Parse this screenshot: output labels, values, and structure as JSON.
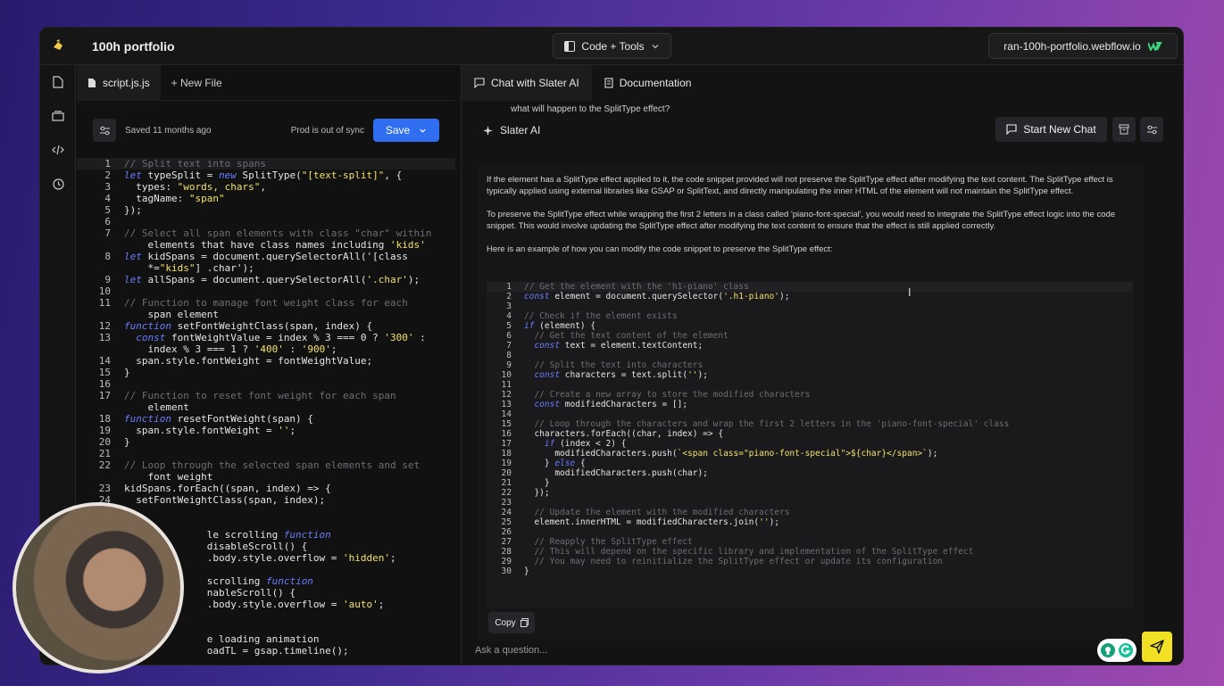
{
  "topbar": {
    "project_title": "100h portfolio",
    "mode_label": "Code + Tools",
    "domain_label": "ran-100h-portfolio.webflow.io"
  },
  "editor": {
    "tabs": [
      {
        "label": "script.js.js",
        "icon": "file-icon"
      },
      {
        "label": "+ New File",
        "icon": "plus-icon"
      }
    ],
    "saved_text": "Saved 11 months ago",
    "sync_text": "Prod is out of sync",
    "save_label": "Save",
    "lines": [
      {
        "n": "1",
        "t": "// Split text into spans"
      },
      {
        "n": "2",
        "t": "let typeSplit = new SplitType(\"[text-split]\", {"
      },
      {
        "n": "3",
        "t": "  types: \"words, chars\","
      },
      {
        "n": "4",
        "t": "  tagName: \"span\""
      },
      {
        "n": "5",
        "t": "});"
      },
      {
        "n": "6",
        "t": ""
      },
      {
        "n": "7",
        "t": "// Select all span elements with class \"char\" within"
      },
      {
        "n": "",
        "t": "    elements that have class names including 'kids'"
      },
      {
        "n": "8",
        "t": "let kidSpans = document.querySelectorAll('[class"
      },
      {
        "n": "",
        "t": "    *=\"kids\"] .char');"
      },
      {
        "n": "9",
        "t": "let allSpans = document.querySelectorAll('.char');"
      },
      {
        "n": "10",
        "t": ""
      },
      {
        "n": "11",
        "t": "// Function to manage font weight class for each"
      },
      {
        "n": "",
        "t": "    span element"
      },
      {
        "n": "12",
        "t": "function setFontWeightClass(span, index) {"
      },
      {
        "n": "13",
        "t": "  const fontWeightValue = index % 3 === 0 ? '300' :"
      },
      {
        "n": "",
        "t": "    index % 3 === 1 ? '400' : '900';"
      },
      {
        "n": "14",
        "t": "  span.style.fontWeight = fontWeightValue;"
      },
      {
        "n": "15",
        "t": "}"
      },
      {
        "n": "16",
        "t": ""
      },
      {
        "n": "17",
        "t": "// Function to reset font weight for each span"
      },
      {
        "n": "",
        "t": "    element"
      },
      {
        "n": "18",
        "t": "function resetFontWeight(span) {"
      },
      {
        "n": "19",
        "t": "  span.style.fontWeight = '';"
      },
      {
        "n": "20",
        "t": "}"
      },
      {
        "n": "21",
        "t": ""
      },
      {
        "n": "22",
        "t": "// Loop through the selected span elements and set"
      },
      {
        "n": "",
        "t": "    font weight"
      },
      {
        "n": "23",
        "t": "kidSpans.forEach((span, index) => {"
      },
      {
        "n": "24",
        "t": "  setFontWeightClass(span, index);"
      },
      {
        "n": "",
        "t": ""
      },
      {
        "n": "",
        "t": ""
      },
      {
        "n": "",
        "t": "              le scrolling function"
      },
      {
        "n": "",
        "t": "              disableScroll() {"
      },
      {
        "n": "",
        "t": "              .body.style.overflow = 'hidden';"
      },
      {
        "n": "",
        "t": ""
      },
      {
        "n": "",
        "t": "              scrolling function"
      },
      {
        "n": "",
        "t": "              nableScroll() {"
      },
      {
        "n": "",
        "t": "              .body.style.overflow = 'auto';"
      },
      {
        "n": "",
        "t": ""
      },
      {
        "n": "",
        "t": ""
      },
      {
        "n": "",
        "t": "              e loading animation"
      },
      {
        "n": "",
        "t": "              oadTL = gsap.timeline();"
      }
    ]
  },
  "chat": {
    "tabs": [
      {
        "label": "Chat with Slater AI",
        "icon": "chat-icon"
      },
      {
        "label": "Documentation",
        "icon": "document-icon"
      }
    ],
    "previous_message": "what will happen to the SplitType effect?",
    "assistant_name": "Slater AI",
    "new_chat_label": "Start New Chat",
    "paragraphs": [
      "If the element has a SplitType effect applied to it, the code snippet provided will not preserve the SplitType effect after modifying the text content. The SplitType effect is typically applied using external libraries like GSAP or SplitText, and directly manipulating the inner HTML of the element will not maintain the SplitType effect.",
      "To preserve the SplitType effect while wrapping the first 2 letters in a class called 'piano-font-special', you would need to integrate the SplitType effect logic into the code snippet. This would involve updating the SplitType effect after modifying the text content to ensure that the effect is still applied correctly.",
      "Here is an example of how you can modify the code snippet to preserve the SplitType effect:"
    ],
    "snippet_lines": [
      {
        "n": "1",
        "t": "// Get the element with the 'h1-piano' class"
      },
      {
        "n": "2",
        "t": "const element = document.querySelector('.h1-piano');"
      },
      {
        "n": "3",
        "t": ""
      },
      {
        "n": "4",
        "t": "// Check if the element exists"
      },
      {
        "n": "5",
        "t": "if (element) {"
      },
      {
        "n": "6",
        "t": "  // Get the text content of the element"
      },
      {
        "n": "7",
        "t": "  const text = element.textContent;"
      },
      {
        "n": "8",
        "t": ""
      },
      {
        "n": "9",
        "t": "  // Split the text into characters"
      },
      {
        "n": "10",
        "t": "  const characters = text.split('');"
      },
      {
        "n": "11",
        "t": ""
      },
      {
        "n": "12",
        "t": "  // Create a new array to store the modified characters"
      },
      {
        "n": "13",
        "t": "  const modifiedCharacters = [];"
      },
      {
        "n": "14",
        "t": ""
      },
      {
        "n": "15",
        "t": "  // Loop through the characters and wrap the first 2 letters in the 'piano-font-special' class"
      },
      {
        "n": "16",
        "t": "  characters.forEach((char, index) => {"
      },
      {
        "n": "17",
        "t": "    if (index < 2) {"
      },
      {
        "n": "18",
        "t": "      modifiedCharacters.push(`<span class=\"piano-font-special\">${char}</span>`);"
      },
      {
        "n": "19",
        "t": "    } else {"
      },
      {
        "n": "20",
        "t": "      modifiedCharacters.push(char);"
      },
      {
        "n": "21",
        "t": "    }"
      },
      {
        "n": "22",
        "t": "  });"
      },
      {
        "n": "23",
        "t": ""
      },
      {
        "n": "24",
        "t": "  // Update the element with the modified characters"
      },
      {
        "n": "25",
        "t": "  element.innerHTML = modifiedCharacters.join('');"
      },
      {
        "n": "26",
        "t": ""
      },
      {
        "n": "27",
        "t": "  // Reapply the SplitType effect"
      },
      {
        "n": "28",
        "t": "  // This will depend on the specific library and implementation of the SplitType effect"
      },
      {
        "n": "29",
        "t": "  // You may need to reinitialize the SplitType effect or update its configuration"
      },
      {
        "n": "30",
        "t": "}"
      }
    ],
    "copy_label": "Copy",
    "ask_placeholder": "Ask a question..."
  },
  "colors": {
    "accent_blue": "#2f6ef0",
    "send_yellow": "#f2e025",
    "keyword": "#6b7cff",
    "string": "#f2e26b",
    "comment": "#6d6d74"
  }
}
